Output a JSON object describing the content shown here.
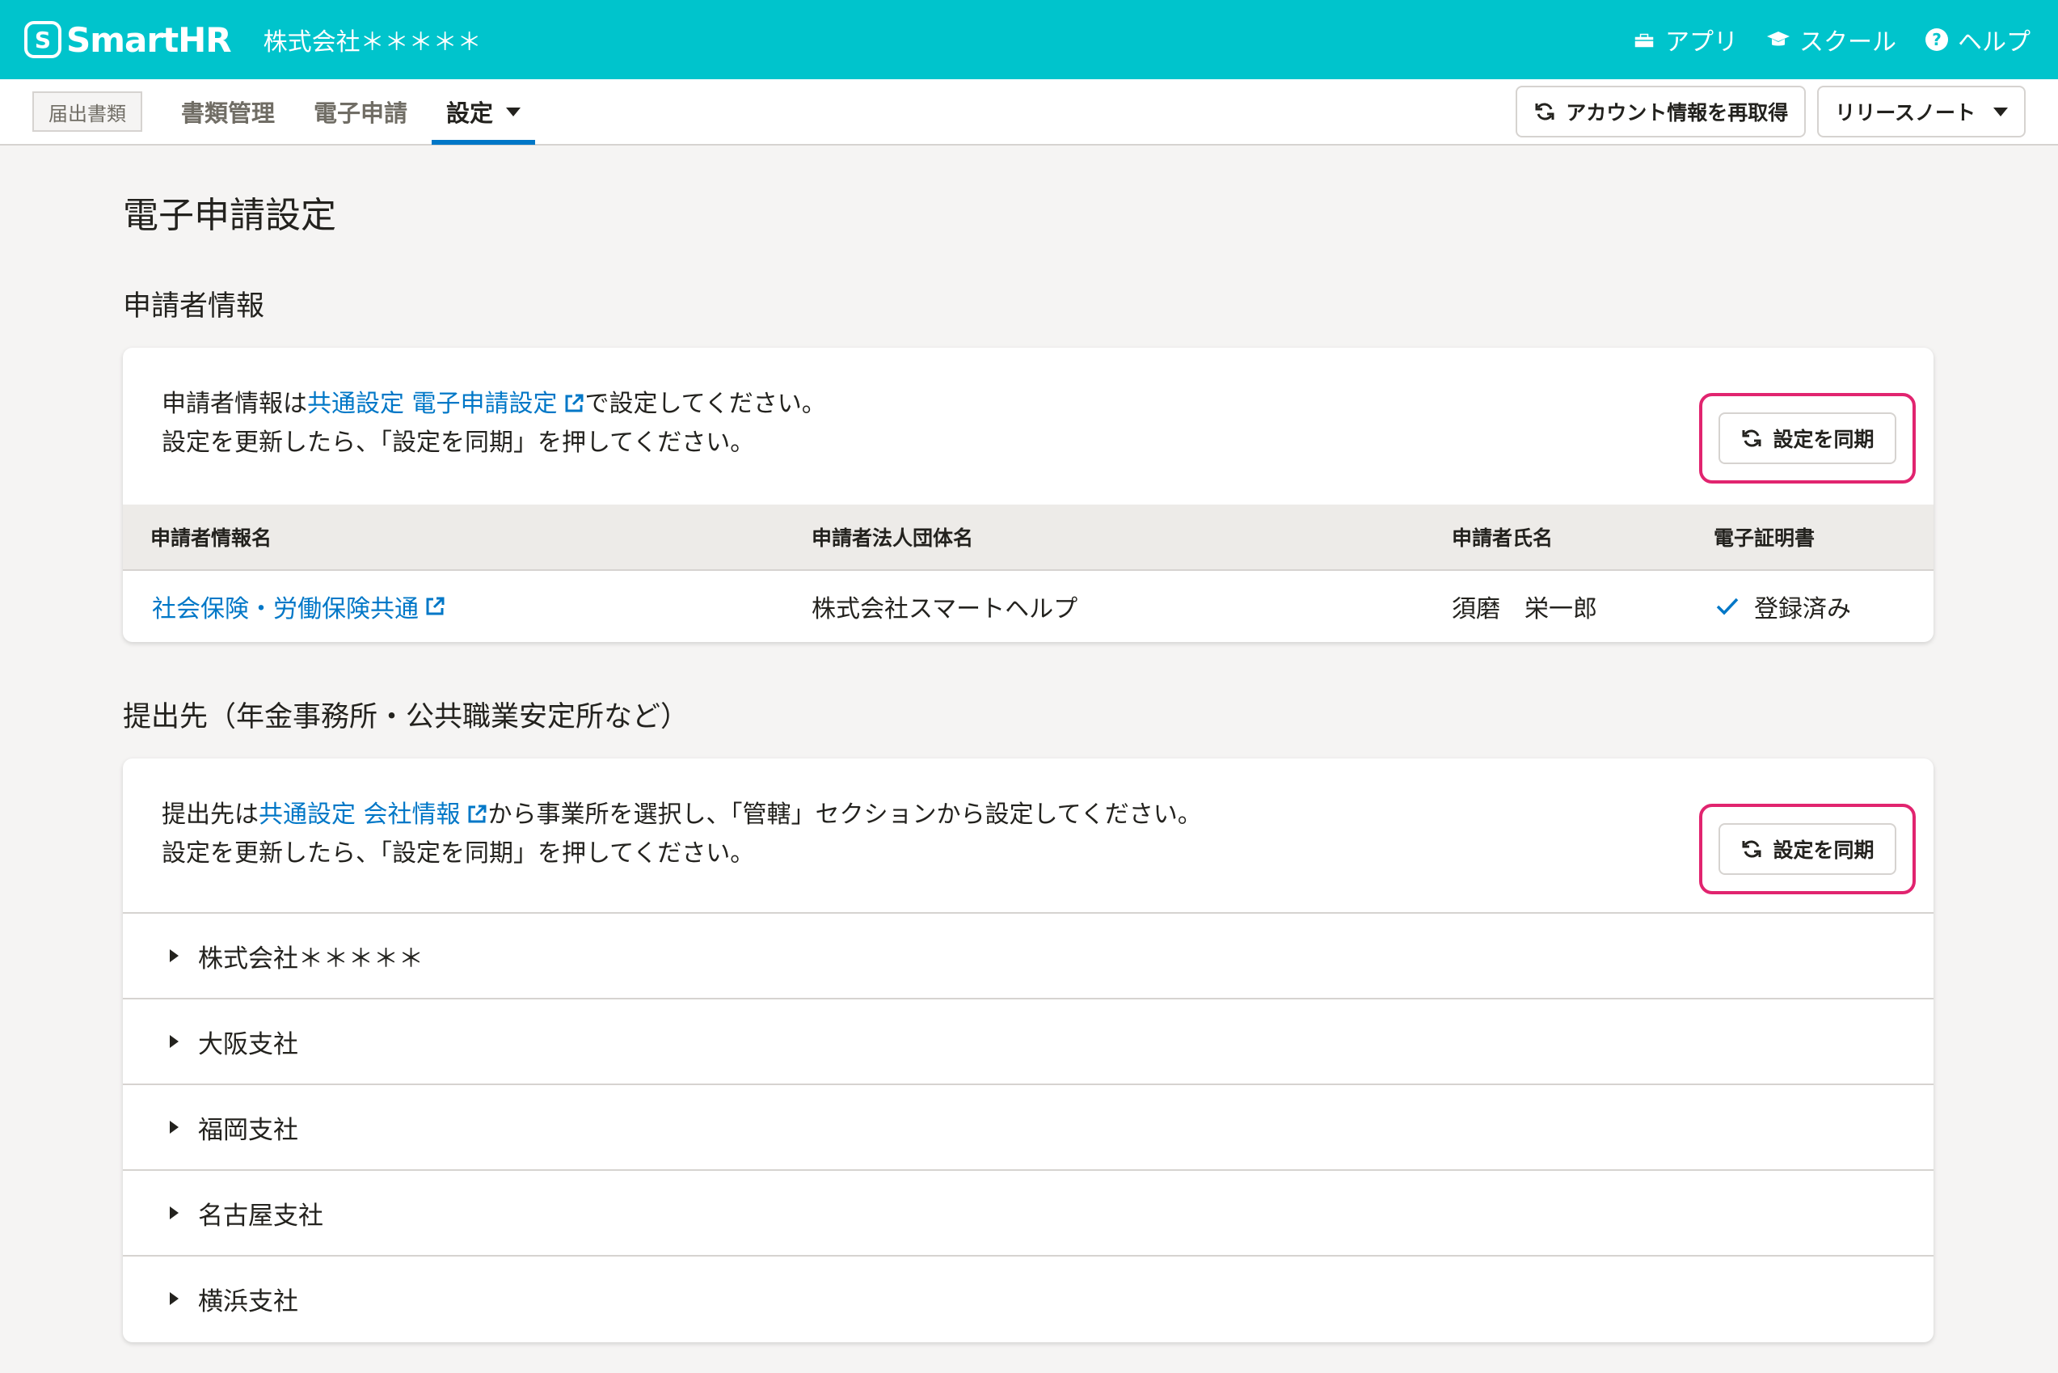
{
  "header": {
    "logo_text": "SmartHR",
    "logo_mark": "S",
    "tenant": "株式会社＊＊＊＊＊",
    "links": [
      {
        "label": "アプリ",
        "icon": "apps-icon"
      },
      {
        "label": "スクール",
        "icon": "graduation-cap-icon"
      },
      {
        "label": "ヘルプ",
        "icon": "help-circle-icon"
      }
    ]
  },
  "subnav": {
    "badge": "届出書類",
    "items": [
      "書類管理",
      "電子申請",
      "設定"
    ],
    "active": "設定",
    "refresh_account": "アカウント情報を再取得",
    "release_notes": "リリースノート"
  },
  "page": {
    "title": "電子申請設定"
  },
  "applicant": {
    "section_title": "申請者情報",
    "desc_prefix": "申請者情報は",
    "desc_link": "共通設定 電子申請設定",
    "desc_suffix": "で設定してください。",
    "desc_line2": "設定を更新したら、「設定を同期」を押してください。",
    "sync_label": "設定を同期",
    "columns": [
      "申請者情報名",
      "申請者法人団体名",
      "申請者氏名",
      "電子証明書"
    ],
    "row": {
      "name": "社会保険・労働保険共通",
      "corp": "株式会社スマートヘルプ",
      "person": "須磨　栄一郎",
      "cert": "登録済み"
    }
  },
  "destination": {
    "section_title": "提出先（年金事務所・公共職業安定所など）",
    "desc_prefix": "提出先は",
    "desc_link": "共通設定 会社情報",
    "desc_suffix": "から事業所を選択し、「管轄」セクションから設定してください。",
    "desc_line2": "設定を更新したら、「設定を同期」を押してください。",
    "sync_label": "設定を同期",
    "offices": [
      "株式会社＊＊＊＊＊",
      "大阪支社",
      "福岡支社",
      "名古屋支社",
      "横浜支社"
    ]
  },
  "colors": {
    "brand": "#00c4cc",
    "link": "#0077c7",
    "highlight": "#e1246f"
  }
}
